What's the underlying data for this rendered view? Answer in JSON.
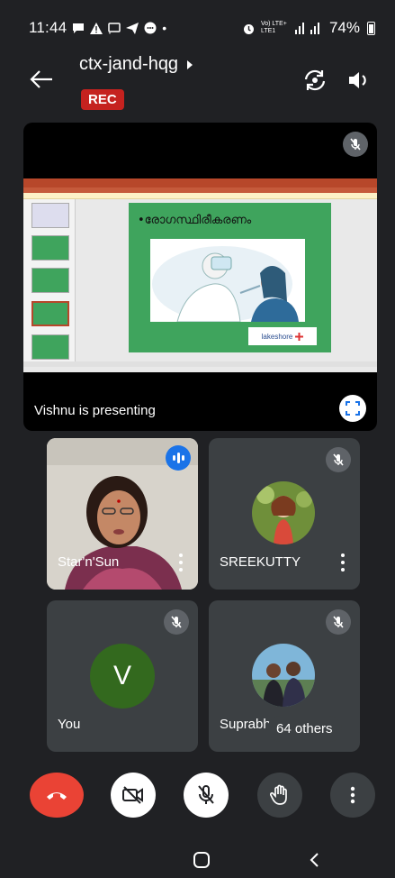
{
  "status_bar": {
    "time": "11:44",
    "dot": "•",
    "network_label": "Vo) LTE+ LTE1",
    "battery": "74%",
    "icons": [
      "message-icon",
      "alert-icon",
      "screen-cast-icon",
      "telegram-icon",
      "chat-icon",
      "alarm-icon",
      "signal-icon",
      "battery-icon"
    ]
  },
  "header": {
    "meeting_code": "ctx-jand-hqg",
    "rec_label": "REC"
  },
  "presentation": {
    "label": "Vishnu is presenting",
    "slide_heading": "•രോഗസ്ഥിരീകരണം",
    "slide_logo_text": "lakeshore"
  },
  "participants": [
    {
      "name": "Star'n'Sun",
      "speaking": true
    },
    {
      "name": "SREEKUTTY",
      "muted": true
    },
    {
      "name": "You",
      "initial": "V",
      "muted": true
    },
    {
      "name": "Suprabh",
      "muted": true
    }
  ],
  "others_label": "64 others",
  "colors": {
    "background": "#202124",
    "tile": "#3c4043",
    "end_call": "#ea4335",
    "rec": "#c5221f",
    "speaking": "#1a73e8",
    "avatar_green": "#33691e"
  }
}
